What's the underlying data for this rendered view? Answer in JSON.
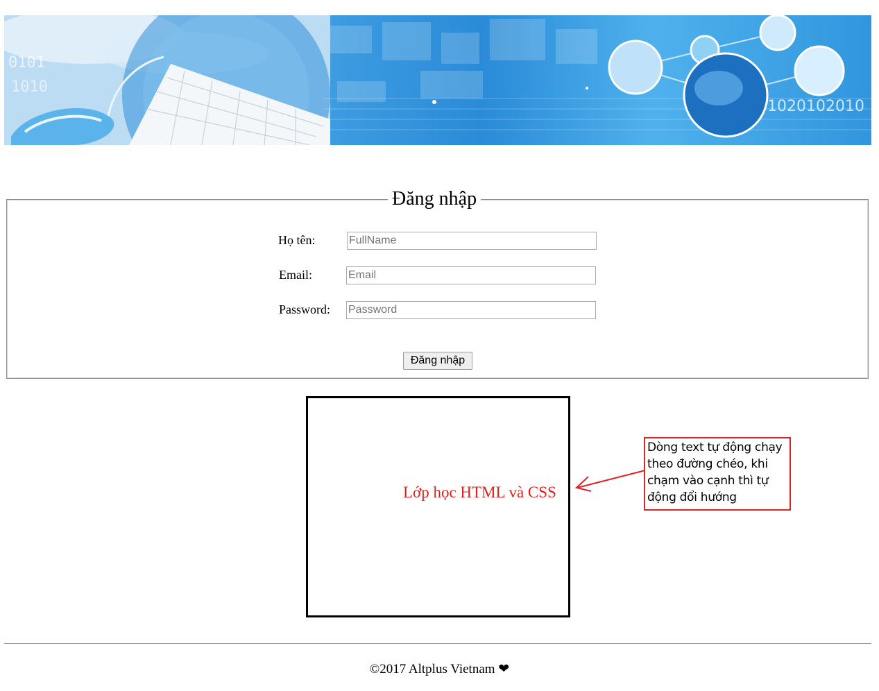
{
  "header": {
    "banner_digits_right": "1020102010"
  },
  "login": {
    "legend": "Đăng nhập",
    "fullname": {
      "label": "Họ tên:",
      "placeholder": "FullName",
      "value": ""
    },
    "email": {
      "label": "Email:",
      "placeholder": "Email",
      "value": ""
    },
    "password": {
      "label": "Password:",
      "placeholder": "Password",
      "value": ""
    },
    "submit_label": "Đăng nhập"
  },
  "marquee": {
    "text": "Lớp học HTML và CSS",
    "color": "#e0201f"
  },
  "annotation": {
    "lines": [
      "Dòng text tự động chạy",
      "theo đường chéo, khi",
      "chạm vào cạnh thì tự",
      "động đổi hướng"
    ],
    "color": "#e02227"
  },
  "footer": {
    "copyright": "©2017 Altplus Vietnam",
    "heart": "❤"
  }
}
